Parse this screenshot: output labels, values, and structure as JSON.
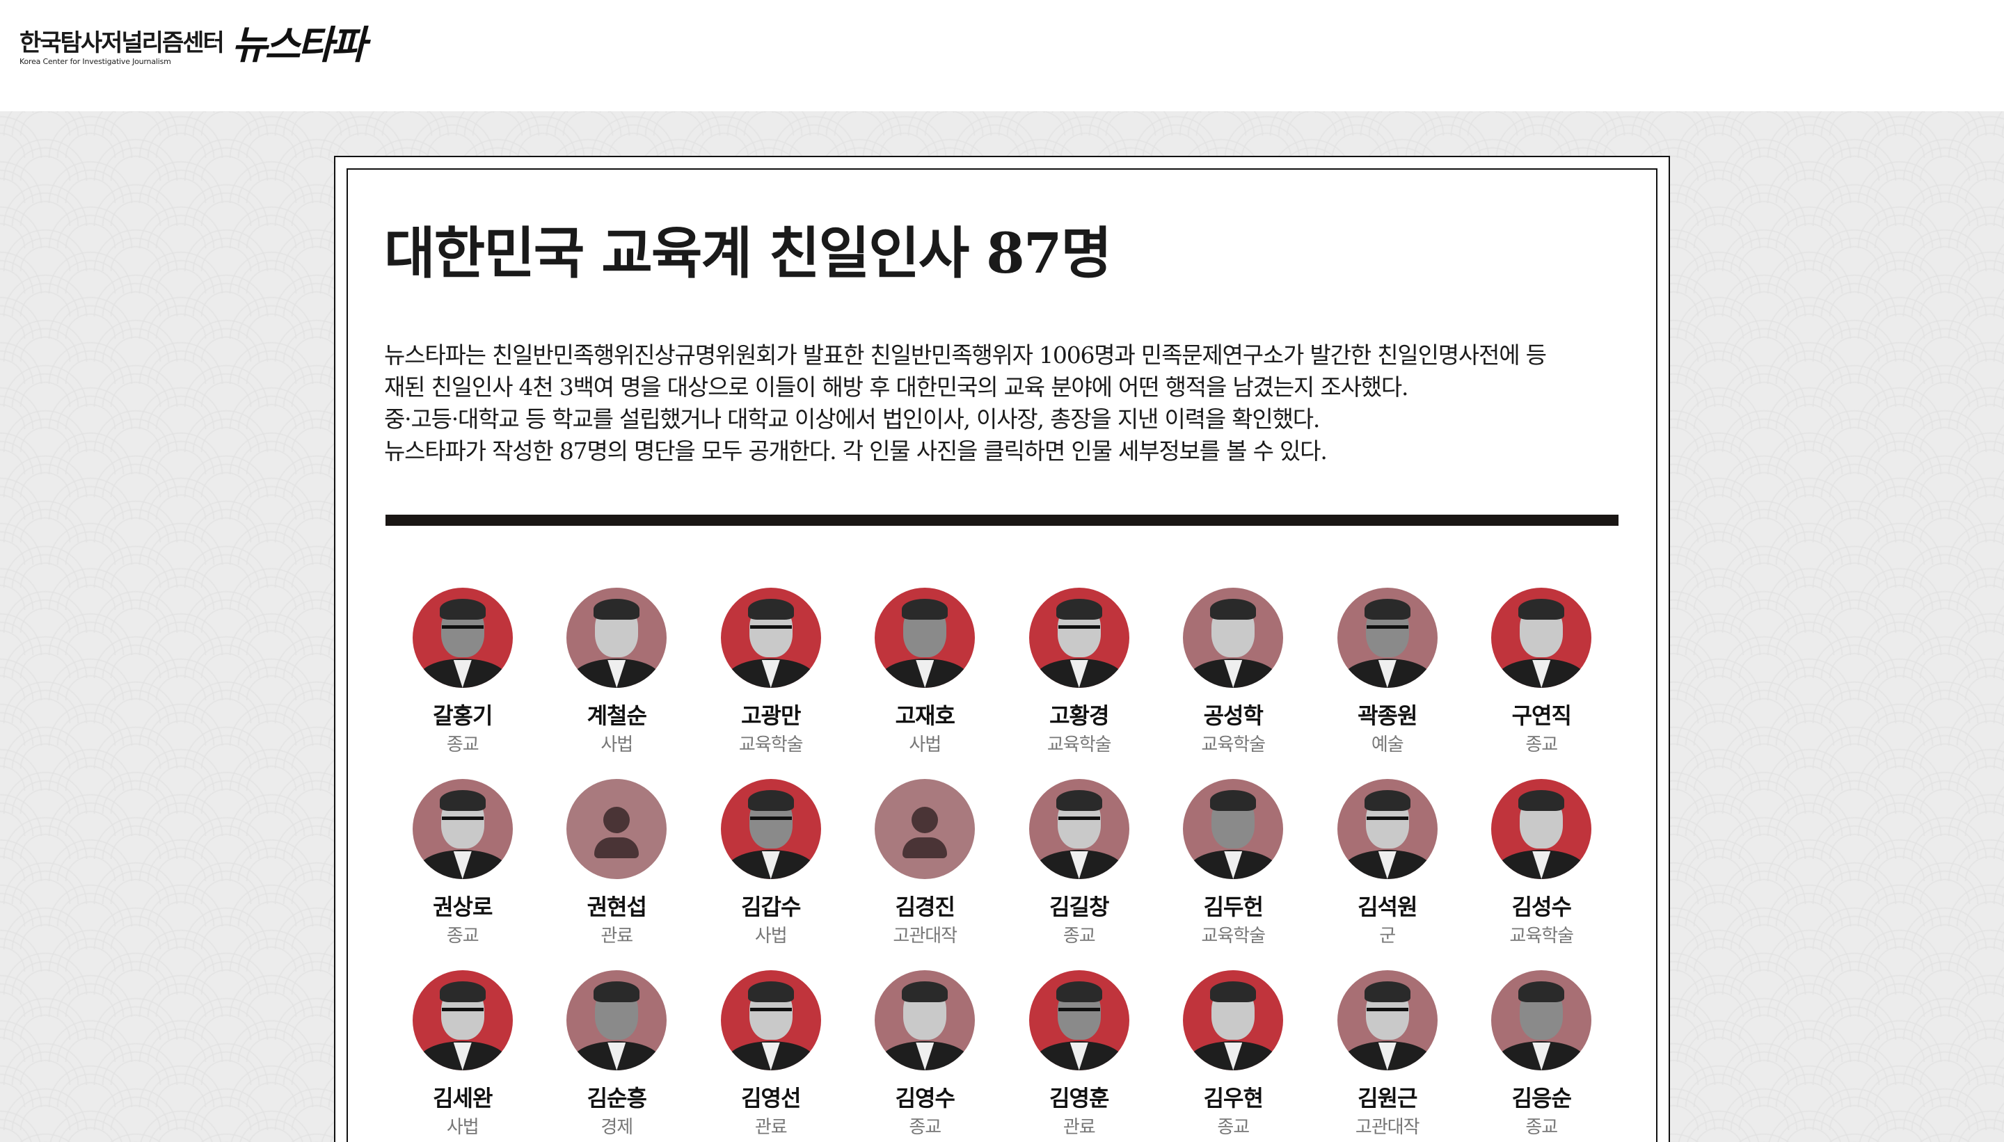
{
  "header": {
    "logo_ko": "한국탐사저널리즘센터",
    "logo_en": "Korea Center for Investigative Journalism",
    "brand": "뉴스타파"
  },
  "article": {
    "title": "대한민국 교육계 친일인사 87명",
    "desc": [
      "뉴스타파는 친일반민족행위진상규명위원회가 발표한 친일반민족행위자 1006명과 민족문제연구소가 발간한 친일인명사전에 등",
      "재된 친일인사 4천 3백여 명을 대상으로 이들이 해방 후 대한민국의 교육 분야에 어떤 행적을 남겼는지 조사했다.",
      "중·고등·대학교 등 학교를 설립했거나 대학교 이상에서 법인이사, 이사장, 총장을 지낸 이력을 확인했다.",
      "뉴스타파가 작성한 87명의 명단을 모두 공개한다. 각 인물 사진을 클릭하면 인물 세부정보를 볼 수 있다."
    ]
  },
  "people": [
    [
      {
        "name": "갈홍기",
        "category": "종교",
        "bg": "red",
        "photo": "portrait"
      },
      {
        "name": "계철순",
        "category": "사법",
        "bg": "mauve",
        "photo": "portrait"
      },
      {
        "name": "고광만",
        "category": "교육학술",
        "bg": "red",
        "photo": "portrait"
      },
      {
        "name": "고재호",
        "category": "사법",
        "bg": "red",
        "photo": "portrait"
      },
      {
        "name": "고황경",
        "category": "교육학술",
        "bg": "red",
        "photo": "portrait"
      },
      {
        "name": "공성학",
        "category": "교육학술",
        "bg": "mauve",
        "photo": "portrait"
      },
      {
        "name": "곽종원",
        "category": "예술",
        "bg": "mauve",
        "photo": "portrait"
      },
      {
        "name": "구연직",
        "category": "종교",
        "bg": "red",
        "photo": "portrait"
      }
    ],
    [
      {
        "name": "권상로",
        "category": "종교",
        "bg": "mauve",
        "photo": "portrait"
      },
      {
        "name": "권현섭",
        "category": "관료",
        "bg": "light",
        "photo": "placeholder"
      },
      {
        "name": "김갑수",
        "category": "사법",
        "bg": "red",
        "photo": "portrait"
      },
      {
        "name": "김경진",
        "category": "고관대작",
        "bg": "light",
        "photo": "placeholder"
      },
      {
        "name": "김길창",
        "category": "종교",
        "bg": "mauve",
        "photo": "portrait"
      },
      {
        "name": "김두헌",
        "category": "교육학술",
        "bg": "mauve",
        "photo": "portrait"
      },
      {
        "name": "김석원",
        "category": "군",
        "bg": "mauve",
        "photo": "portrait"
      },
      {
        "name": "김성수",
        "category": "교육학술",
        "bg": "red",
        "photo": "portrait"
      }
    ],
    [
      {
        "name": "김세완",
        "category": "사법",
        "bg": "red",
        "photo": "portrait"
      },
      {
        "name": "김순흥",
        "category": "경제",
        "bg": "mauve",
        "photo": "portrait"
      },
      {
        "name": "김영선",
        "category": "관료",
        "bg": "red",
        "photo": "portrait"
      },
      {
        "name": "김영수",
        "category": "종교",
        "bg": "mauve",
        "photo": "portrait"
      },
      {
        "name": "김영훈",
        "category": "관료",
        "bg": "red",
        "photo": "portrait"
      },
      {
        "name": "김우현",
        "category": "종교",
        "bg": "red",
        "photo": "portrait"
      },
      {
        "name": "김원근",
        "category": "고관대작",
        "bg": "mauve",
        "photo": "portrait"
      },
      {
        "name": "김응순",
        "category": "종교",
        "bg": "mauve",
        "photo": "portrait"
      }
    ]
  ],
  "colors": {
    "red": "#c0343c",
    "mauve": "#a86f74",
    "light": "#a97a7e",
    "rule": "#1a1614"
  }
}
